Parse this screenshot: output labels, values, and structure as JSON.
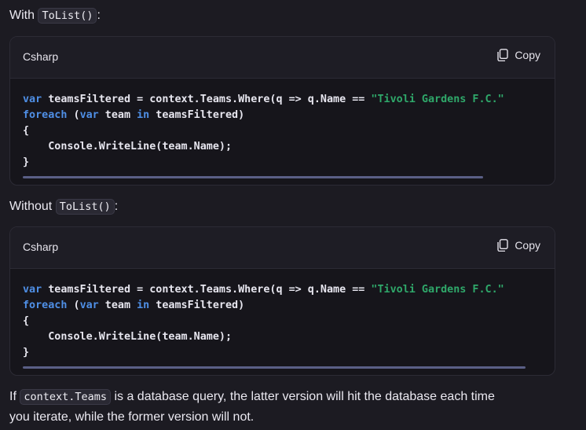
{
  "sections": [
    {
      "intro_prefix": "With",
      "intro_code": "ToList()",
      "intro_suffix": ":",
      "language": "Csharp",
      "copy_label": "Copy",
      "code": {
        "l1_var": "var",
        "l1_rest": " teamsFiltered = context.Teams.Where(q => q.Name == ",
        "l1_str": "\"Tivoli Gardens F.C.\"",
        "l2_foreach": "foreach",
        "l2_open": " (",
        "l2_var": "var",
        "l2_team": " team ",
        "l2_in": "in",
        "l2_rest": " teamsFiltered)",
        "l3": "{",
        "l4": "    Console.WriteLine(team.Name);",
        "l5": "}"
      }
    },
    {
      "intro_prefix": "Without",
      "intro_code": "ToList()",
      "intro_suffix": ":",
      "language": "Csharp",
      "copy_label": "Copy",
      "code": {
        "l1_var": "var",
        "l1_rest": " teamsFiltered = context.Teams.Where(q => q.Name == ",
        "l1_str": "\"Tivoli Gardens F.C.\"",
        "l2_foreach": "foreach",
        "l2_open": " (",
        "l2_var": "var",
        "l2_team": " team ",
        "l2_in": "in",
        "l2_rest": " teamsFiltered)",
        "l3": "{",
        "l4": "    Console.WriteLine(team.Name);",
        "l5": "}"
      }
    }
  ],
  "footer": {
    "prefix": "If ",
    "code": "context.Teams",
    "suffix": " is a database query, the latter version will hit the database each time",
    "line2": "you iterate, while the former version will not."
  },
  "colors": {
    "background": "#1c1b22",
    "code_background": "#16151b",
    "keyword": "#4f8fe6",
    "string": "#2fa86a"
  }
}
